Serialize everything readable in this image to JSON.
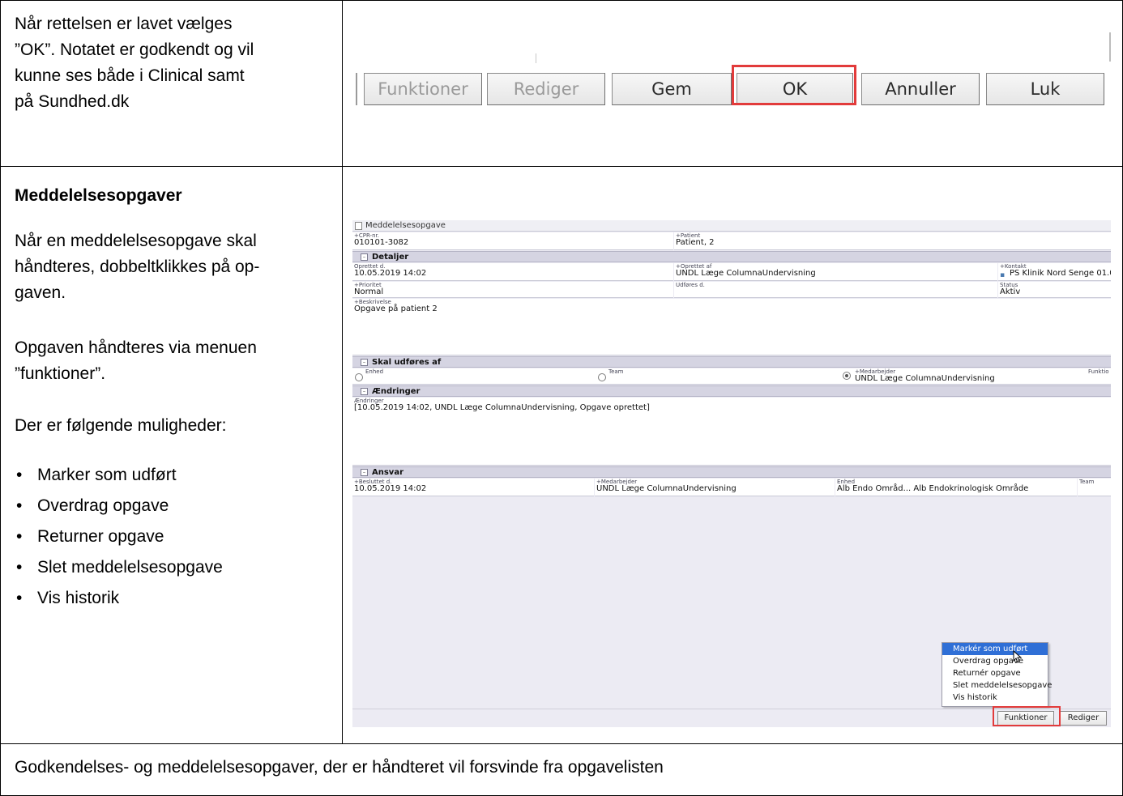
{
  "row1": {
    "text": "Når rettelsen er lavet vælges ”OK”. Notatet er godkendt og vil kunne ses både i Clinical samt på Sundhed.dk",
    "line1": "Når rettelsen er lavet vælges",
    "line2": "”OK”. Notatet er godkendt og vil",
    "line3": "kunne ses både i Clinical samt",
    "line4": "på Sundhed.dk",
    "buttons": [
      "Funktioner",
      "Rediger",
      "Gem",
      "OK",
      "Annuller",
      "Luk"
    ]
  },
  "row2": {
    "heading": "Meddelelsesopgaver",
    "p1_l1": "Når en meddelelsesopgave skal",
    "p1_l2": "håndteres, dobbeltklikkes på op-",
    "p1_l3": "gaven.",
    "p2_l1": "Opgaven håndteres via menuen",
    "p2_l2": "”funktioner”.",
    "p3": "Der er følgende muligheder:",
    "bullets": [
      "Marker som udført",
      "Overdrag opgave",
      "Returner opgave",
      "Slet meddelelsesopgave",
      "Vis historik"
    ]
  },
  "panel": {
    "title": "Meddelelsesopgave",
    "cpr_label": "+CPR-nr.",
    "cpr_value": "010101-3082",
    "patient_label": "+Patient",
    "patient_value": "Patient, 2",
    "sec_detaljer": "Detaljer",
    "oprettet_label": "Oprettet d.",
    "oprettet_value": "10.05.2019 14:02",
    "oprettet_af_label": "+Oprettet af",
    "oprettet_af_value": "UNDL Læge ColumnaUndervisning",
    "kontakt_label": "+Kontakt",
    "kontakt_value": "PS Klinik Nord Senge 01.0",
    "prioritet_label": "+Prioritet",
    "prioritet_value": "Normal",
    "udfores_label": "Udføres d.",
    "status_label": "Status",
    "status_value": "Aktiv",
    "beskrivelse_label": "+Beskrivelse",
    "beskrivelse_value": "Opgave på patient 2",
    "sec_skal": "Skal udføres af",
    "enhed_label": "Enhed",
    "team_label": "Team",
    "medarbejder_label": "+Medarbejder",
    "medarbejder_value": "UNDL Læge ColumnaUndervisning",
    "funktion_label": "Funktio",
    "sec_aendringer": "Ændringer",
    "aendringer_label": "Ændringer",
    "aendringer_value": "[10.05.2019 14:02, UNDL Læge ColumnaUndervisning, Opgave oprettet]",
    "sec_ansvar": "Ansvar",
    "besluttet_label": "+Besluttet d.",
    "besluttet_value": "10.05.2019 14:02",
    "ansvar_medarb_label": "+Medarbejder",
    "ansvar_medarb_value": "UNDL Læge ColumnaUndervisning",
    "ansvar_enhed_label": "Enhed",
    "ansvar_enhed_value": "Alb Endo Områd... Alb Endokrinologisk Område",
    "ansvar_team_label": "Team",
    "menu": [
      "Markér som udført",
      "Overdrag opgave",
      "Returnér opgave",
      "Slet meddelelsesopgave",
      "Vis historik"
    ],
    "funktioner_btn": "Funktioner",
    "rediger_btn": "Rediger"
  },
  "footer": {
    "text": "Godkendelses- og meddelelsesopgaver, der er håndteret vil forsvinde fra opgavelisten"
  },
  "colors": {
    "highlight": "#e23b3b",
    "menu_selected": "#2f6fd6",
    "panel_bg": "#ecebf3"
  }
}
